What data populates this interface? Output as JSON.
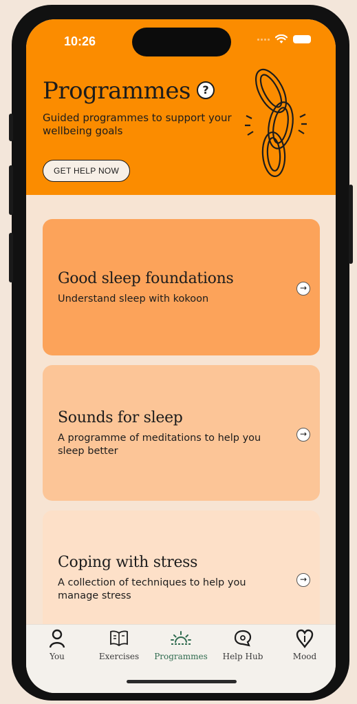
{
  "status": {
    "time": "10:26"
  },
  "header": {
    "title": "Programmes",
    "help_glyph": "?",
    "subtitle": "Guided programmes to support your wellbeing goals",
    "help_button": "GET HELP NOW",
    "illustration": "chain-links-icon"
  },
  "cards": [
    {
      "title": "Good sleep foundations",
      "description": "Understand sleep with kokoon",
      "color": "#fca35a"
    },
    {
      "title": "Sounds for sleep",
      "description": "A programme of meditations to help you sleep better",
      "color": "#fcc597"
    },
    {
      "title": "Coping with stress",
      "description": "A collection of techniques to help you manage stress",
      "color": "#fde0c8"
    }
  ],
  "tabs": [
    {
      "label": "You",
      "icon": "person-icon",
      "active": false
    },
    {
      "label": "Exercises",
      "icon": "book-icon",
      "active": false
    },
    {
      "label": "Programmes",
      "icon": "sunrise-icon",
      "active": true
    },
    {
      "label": "Help Hub",
      "icon": "chat-bubble-icon",
      "active": false
    },
    {
      "label": "Mood",
      "icon": "heart-icon",
      "active": false
    }
  ],
  "colors": {
    "header_bg": "#fb8c00",
    "active_tab": "#2f6b4f"
  }
}
